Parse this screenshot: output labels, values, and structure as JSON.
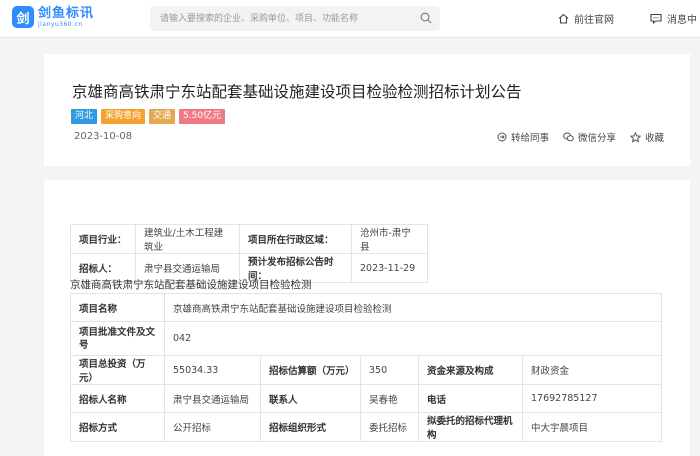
{
  "logo": {
    "name": "剑鱼标讯",
    "sub": "jianyu360.cn",
    "mark": "剑"
  },
  "search": {
    "placeholder": "请输入要搜索的企业、采购单位、项目、功能名称"
  },
  "nav": {
    "official_site": "前往官网",
    "messages": "消息中"
  },
  "notice": {
    "title": "京雄商高铁肃宁东站配套基础设施建设项目检验检测招标计划公告",
    "tags": [
      "河北",
      "采购意向",
      "交通",
      "5.50亿元"
    ],
    "date": "2023-10-08",
    "actions": {
      "forward": "转给同事",
      "wechat": "微信分享",
      "favorite": "收藏"
    }
  },
  "summary": {
    "industry_label": "项目行业：",
    "industry_value": "建筑业/土木工程建筑业",
    "region_label": "项目所在行政区域：",
    "region_value": "沧州市-肃宁县",
    "tenderee_label": "招标人：",
    "tenderee_value": "肃宁县交通运输局",
    "publish_label": "预计发布招标公告时间：",
    "publish_value": "2023-11-29"
  },
  "section_title": "京雄商高铁肃宁东站配套基础设施建设项目检验检测",
  "info": {
    "project_name_label": "项目名称",
    "project_name_value": "京雄商高铁肃宁东站配套基础设施建设项目检验检测",
    "approval_label": "项目批准文件及文号",
    "approval_value": "042",
    "investment_label": "项目总投资（万元）",
    "investment_value": "55034.33",
    "estimate_label": "招标估算额（万元）",
    "estimate_value": "350",
    "fund_label": "资金来源及构成",
    "fund_value": "财政资金",
    "tenderee_name_label": "招标人名称",
    "tenderee_name_value": "肃宁县交通运输局",
    "contact_label": "联系人",
    "contact_value": "吴春艳",
    "phone_label": "电话",
    "phone_value": "17692785127",
    "method_label": "招标方式",
    "method_value": "公开招标",
    "org_form_label": "招标组织形式",
    "org_form_value": "委托招标",
    "agency_label": "拟委托的招标代理机构",
    "agency_value": "中大宇晨项目"
  },
  "colors": {
    "brand": "#2f8bff",
    "section_underline": "#36b3c9",
    "tag_region": "#2f9be0",
    "tag_amount": "#f07a84"
  }
}
